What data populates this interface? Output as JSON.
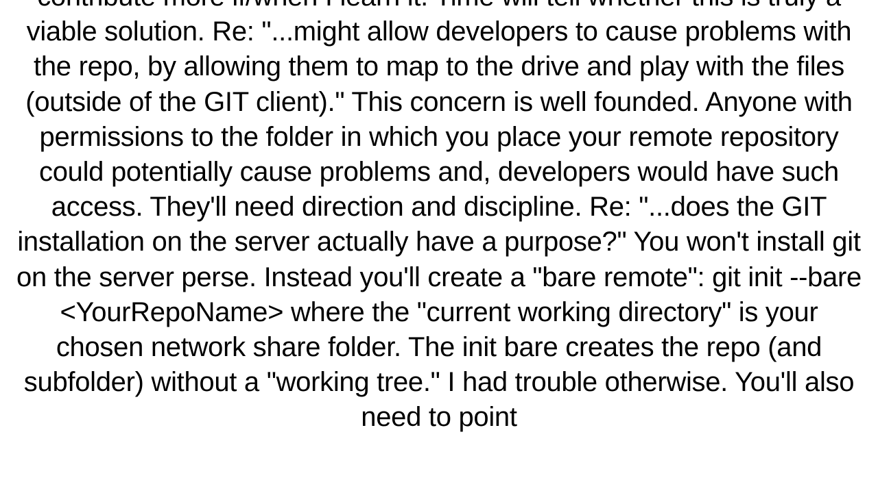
{
  "document": {
    "body_text": "contribute more if/when I learn it. Time will tell whether this is truly a viable solution.  Re: \"...might allow developers to cause problems with the repo, by allowing them to map to the drive and play with the files (outside of the GIT client).\"  This concern is well founded. Anyone with permissions to the folder in which you place your remote repository could potentially cause problems and, developers would have such access. They'll need direction and discipline.   Re: \"...does the GIT installation on the server actually have a purpose?\"  You  won't install git on the server perse. Instead you'll create a \"bare remote\": git init --bare <YourRepoName> where the \"current working directory\" is your chosen network share folder. The init bare creates the repo (and subfolder) without a \"working tree.\" I had trouble otherwise. You'll also need to point"
  }
}
